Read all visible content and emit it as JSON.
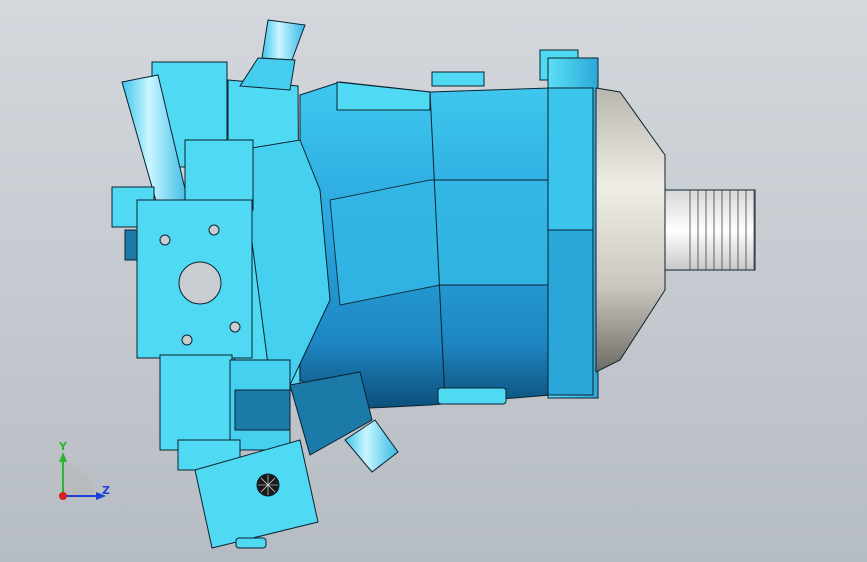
{
  "viewport": {
    "background_top": "#d4d8dd",
    "background_bottom": "#b6bcc3"
  },
  "model": {
    "colors": {
      "light": "#4fd9f2",
      "mid": "#2bb5e0",
      "dark": "#1c7aa8",
      "shadow": "#0f5a82",
      "flange_light": "#47c6ee",
      "cone_light": "#e8e6df",
      "cone_dark": "#8c8a82",
      "spline": "#f2f2f2",
      "outline": "#0b2230"
    }
  },
  "triad": {
    "y_label": "Y",
    "z_label": "Z",
    "y_color": "#2fb32f",
    "z_color": "#1f3fd8",
    "x_color": "#d82020"
  }
}
